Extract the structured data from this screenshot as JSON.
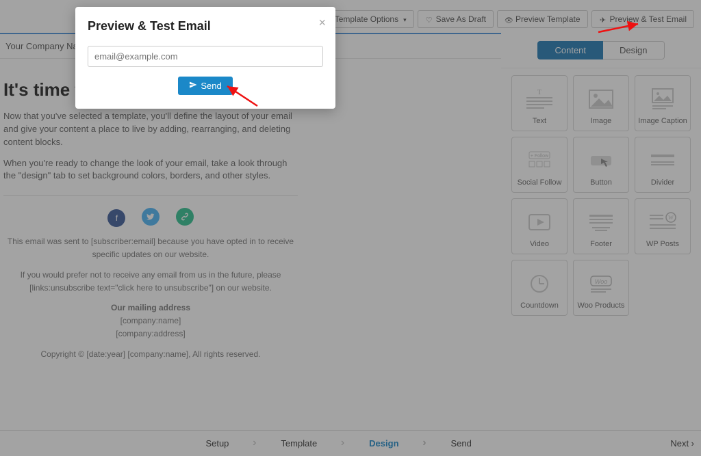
{
  "toolbar": {
    "template_options": "Template Options",
    "save_draft": "Save As Draft",
    "preview_template": "Preview Template",
    "preview_test_email": "Preview & Test Email"
  },
  "company_bar": "Your Company Name",
  "email": {
    "heading": "It's time to design your email.",
    "p1": "Now that you've selected a template, you'll define the layout of your email and give your content a place to live by adding, rearranging, and deleting content blocks.",
    "p2": "When you're ready to change the look of your email, take a look through the \"design\" tab to set background colors, borders, and other styles.",
    "footer_sent": "This email was sent to [subscriber:email] because you have opted in to receive specific updates on our website.",
    "footer_unsub": "If you would prefer not to receive any email from us in the future, please [links:unsubscribe text=\"click here to unsubscribe\"] on our website.",
    "footer_addr_title": "Our mailing address",
    "footer_company": "[company:name]",
    "footer_address": "[company:address]",
    "footer_copyright": "Copyright © [date:year] [company:name], All rights reserved."
  },
  "sidebar": {
    "tabs": {
      "content": "Content",
      "design": "Design"
    },
    "blocks": [
      {
        "label": "Text"
      },
      {
        "label": "Image"
      },
      {
        "label": "Image Caption"
      },
      {
        "label": "Social Follow"
      },
      {
        "label": "Button"
      },
      {
        "label": "Divider"
      },
      {
        "label": "Video"
      },
      {
        "label": "Footer"
      },
      {
        "label": "WP Posts"
      },
      {
        "label": "Countdown"
      },
      {
        "label": "Woo Products"
      }
    ]
  },
  "wizard": {
    "steps": [
      "Setup",
      "Template",
      "Design",
      "Send"
    ],
    "active_index": 2,
    "next": "Next ›"
  },
  "modal": {
    "title": "Preview & Test Email",
    "placeholder": "email@example.com",
    "send": "Send"
  }
}
